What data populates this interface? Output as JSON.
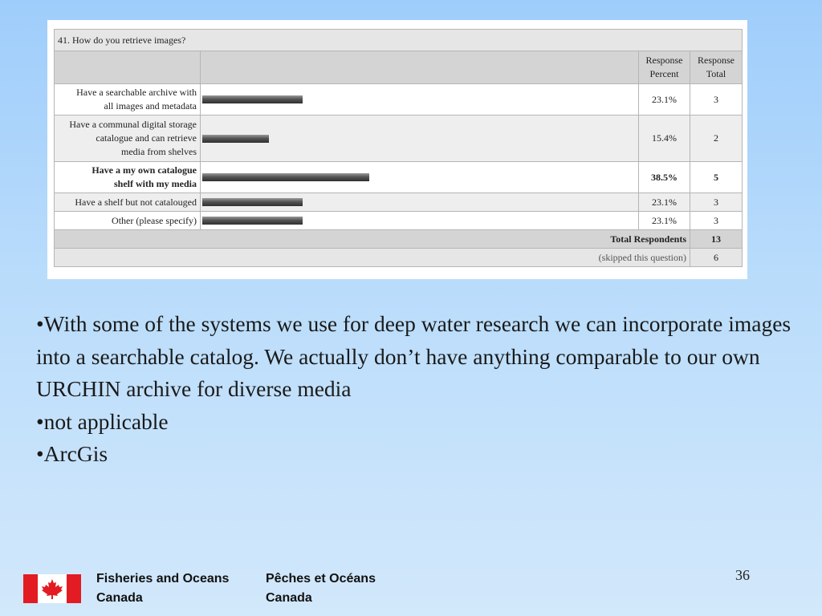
{
  "survey": {
    "question": "41. How do you retrieve images?",
    "col_percent": [
      "Response",
      "Percent"
    ],
    "col_total": [
      "Response",
      "Total"
    ],
    "answers": [
      {
        "label": [
          "Have a searchable archive with",
          "all images and metadata"
        ],
        "percent": "23.1%",
        "total": "3",
        "fraction": 0.231
      },
      {
        "label": [
          "Have a communal digital storage",
          "catalogue and can retrieve",
          "media from shelves"
        ],
        "percent": "15.4%",
        "total": "2",
        "fraction": 0.154
      },
      {
        "label": [
          "Have a my own catalogue",
          "shelf with my media"
        ],
        "percent": "38.5%",
        "total": "5",
        "fraction": 0.385
      },
      {
        "label": [
          "Have a shelf but not catalouged"
        ],
        "percent": "23.1%",
        "total": "3",
        "fraction": 0.231
      },
      {
        "label": [
          "Other (please specify)"
        ],
        "percent": "23.1%",
        "total": "3",
        "fraction": 0.231
      }
    ],
    "total_label": "Total Respondents",
    "total_value": "13",
    "skipped_label": "(skipped this question)",
    "skipped_value": "6"
  },
  "bullets": [
    "•With some of the systems we use for deep water research we can incorporate images into a searchable catalog. We actually don’t have anything comparable to our own URCHIN archive for diverse media",
    "•not applicable",
    "•ArcGis"
  ],
  "footer": {
    "en": [
      "Fisheries and Oceans",
      "Canada"
    ],
    "fr": [
      "Pêches et Océans",
      "Canada"
    ],
    "flag_icon": "canada-flag-icon"
  },
  "page_number": "36",
  "colors": {
    "bar": "#4a4a4a",
    "flag_red": "#e31b23"
  }
}
